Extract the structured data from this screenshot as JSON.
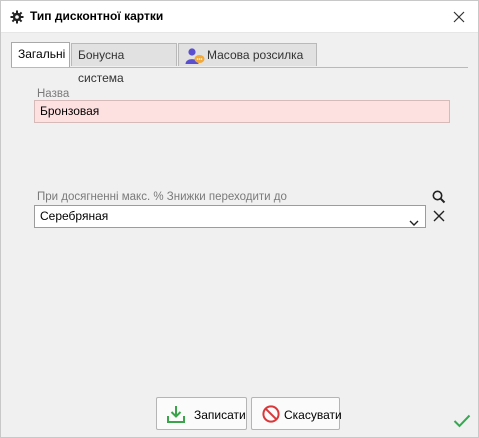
{
  "window": {
    "title": "Тип дисконтної картки",
    "title_icon": "gear-icon",
    "close_icon": "close-icon"
  },
  "tabs": [
    {
      "label": "Загальні",
      "active": true
    },
    {
      "label": "Бонусна система",
      "active": false
    },
    {
      "label": "Масова розсилка",
      "active": false,
      "icon": "person-chat-icon"
    }
  ],
  "form": {
    "name_label": "Назва",
    "name_value": "Бронзовая",
    "goto_label": "При досягненні макс. % Знижки переходити до",
    "goto_value": "Серебряная"
  },
  "buttons": {
    "save_label": "Записати",
    "cancel_label": "Скасувати"
  },
  "colors": {
    "required_field_bg": "#fde0e0",
    "save_icon": "#3aa44a",
    "cancel_icon": "#d9383a",
    "ok_check": "#36a852"
  }
}
